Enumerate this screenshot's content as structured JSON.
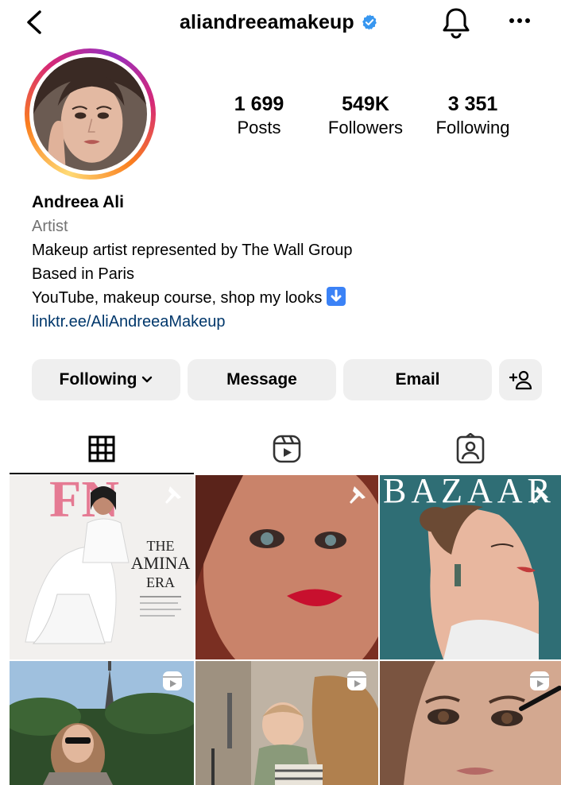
{
  "header": {
    "username": "aliandreeamakeup"
  },
  "profile": {
    "stats": {
      "posts_count": "1 699",
      "posts_label": "Posts",
      "followers_count": "549K",
      "followers_label": "Followers",
      "following_count": "3 351",
      "following_label": "Following"
    },
    "name": "Andreea Ali",
    "category": "Artist",
    "bio_lines": [
      "Makeup artist represented by The Wall Group",
      "Based in Paris",
      "YouTube, makeup course, shop my looks"
    ],
    "link": "linktr.ee/AliAndreeaMakeup"
  },
  "actions": {
    "following_label": "Following",
    "message_label": "Message",
    "email_label": "Email"
  },
  "tabs": [
    {
      "icon": "grid-icon",
      "active": true
    },
    {
      "icon": "reels-icon",
      "active": false
    },
    {
      "icon": "tagged-icon",
      "active": false
    }
  ],
  "posts": [
    {
      "overlay_icon": "pin-icon",
      "cover_text": {
        "logo": "FN",
        "headline_1": "THE",
        "headline_2": "AMINA",
        "headline_3": "ERA"
      }
    },
    {
      "overlay_icon": "pin-icon"
    },
    {
      "overlay_icon": "pin-icon",
      "cover_text": {
        "logo": "BAZAAR"
      }
    },
    {
      "overlay_icon": "reels-icon"
    },
    {
      "overlay_icon": "reels-icon"
    },
    {
      "overlay_icon": "reels-icon"
    }
  ],
  "colors": {
    "link": "#00376b",
    "verified": "#3897f0",
    "button_bg": "#efefef",
    "secondary_text": "#737373"
  }
}
